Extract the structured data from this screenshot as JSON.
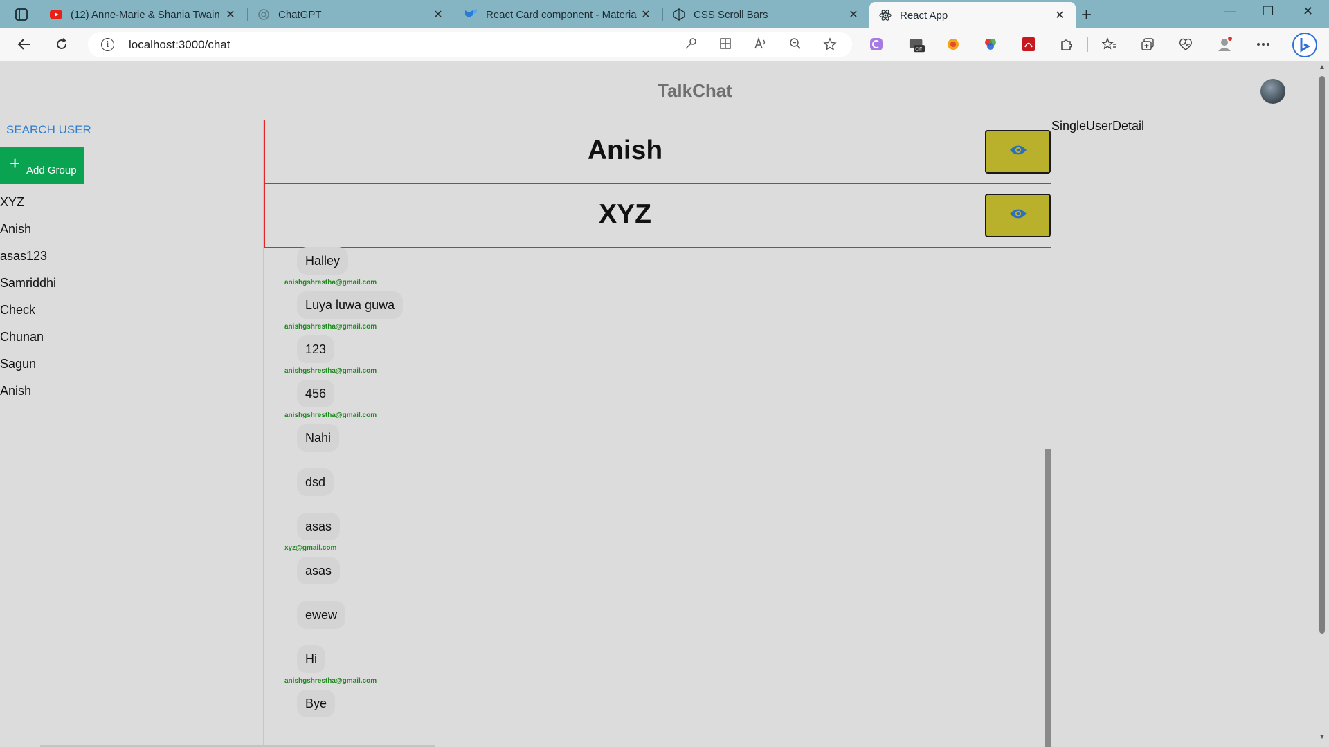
{
  "browser": {
    "tabs": [
      {
        "title": "(12) Anne-Marie & Shania Twain",
        "icon": "youtube-icon"
      },
      {
        "title": "ChatGPT",
        "icon": "chatgpt-icon"
      },
      {
        "title": "React Card component - Materia",
        "icon": "mui-icon"
      },
      {
        "title": "CSS Scroll Bars",
        "icon": "codepen-icon"
      },
      {
        "title": "React App",
        "icon": "react-icon"
      }
    ],
    "active_tab": 4,
    "url": "localhost:3000/chat",
    "tab_close_glyph": "✕",
    "new_tab_glyph": "+",
    "window_controls": {
      "minimize": "—",
      "restore": "❐",
      "close": "✕"
    }
  },
  "app": {
    "title": "TalkChat",
    "sidebar": {
      "search_label": "SEARCH USER",
      "add_group_label": "Add Group",
      "add_group_plus": "+",
      "users": [
        "XYZ",
        "Anish",
        "asas123",
        "Samriddhi",
        "Check",
        "Chunan",
        "Sagun",
        "Anish"
      ]
    },
    "chat_headers": [
      {
        "name": "Anish"
      },
      {
        "name": "XYZ"
      }
    ],
    "messages": [
      {
        "text": "Halley",
        "sender": "anishgshrestha@gmail.com"
      },
      {
        "text": "Luya luwa guwa",
        "sender": "anishgshrestha@gmail.com"
      },
      {
        "text": "123",
        "sender": "anishgshrestha@gmail.com"
      },
      {
        "text": "456",
        "sender": "anishgshrestha@gmail.com"
      },
      {
        "text": "Nahi",
        "sender": ""
      },
      {
        "text": "dsd",
        "sender": ""
      },
      {
        "text": "asas",
        "sender": "xyz@gmail.com"
      },
      {
        "text": "asas",
        "sender": ""
      },
      {
        "text": "ewew",
        "sender": ""
      },
      {
        "text": "Hi",
        "sender": "anishgshrestha@gmail.com"
      },
      {
        "text": "Bye",
        "sender": ""
      }
    ],
    "detail_label": "SingleUserDetail"
  },
  "colors": {
    "tabstrip": "#85b5c2",
    "page_bg": "#dcdcdc",
    "accent_blue": "#2f7fd0",
    "add_group_green": "#0aa352",
    "header_border_red": "#e3262b",
    "eye_button_olive": "#b9b02b",
    "sender_green": "#1e8a1e",
    "title_gray": "#707070"
  }
}
